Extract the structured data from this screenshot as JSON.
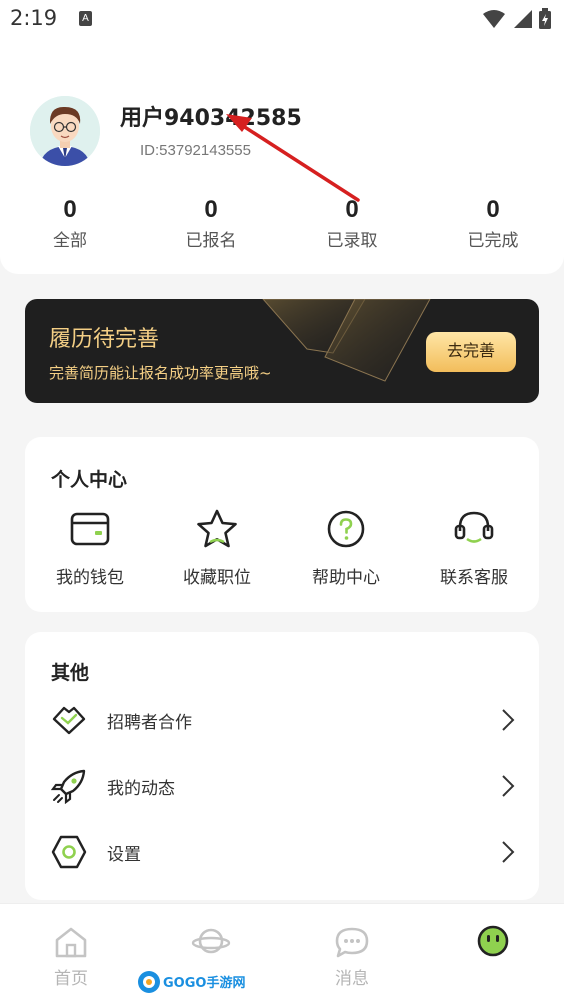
{
  "status_bar": {
    "time": "2:19",
    "badge": "A"
  },
  "profile": {
    "username": "用户940342585",
    "user_id": "ID:53792143555",
    "stats": [
      {
        "value": "0",
        "label": "全部"
      },
      {
        "value": "0",
        "label": "已报名"
      },
      {
        "value": "0",
        "label": "已录取"
      },
      {
        "value": "0",
        "label": "已完成"
      }
    ]
  },
  "resume_banner": {
    "title": "履历待完善",
    "subtitle": "完善简历能让报名成功率更高哦~",
    "button": "去完善"
  },
  "personal_center": {
    "title": "个人中心",
    "items": [
      {
        "label": "我的钱包",
        "icon": "wallet-icon"
      },
      {
        "label": "收藏职位",
        "icon": "star-icon"
      },
      {
        "label": "帮助中心",
        "icon": "help-icon"
      },
      {
        "label": "联系客服",
        "icon": "headset-icon"
      }
    ]
  },
  "other": {
    "title": "其他",
    "items": [
      {
        "label": "招聘者合作",
        "icon": "handshake-icon"
      },
      {
        "label": "我的动态",
        "icon": "rocket-icon"
      },
      {
        "label": "设置",
        "icon": "settings-icon"
      }
    ]
  },
  "bottom_nav": {
    "items": [
      {
        "label": "首页",
        "icon": "home-icon"
      },
      {
        "label": "",
        "icon": "planet-icon"
      },
      {
        "label": "消息",
        "icon": "chat-icon"
      },
      {
        "label": "",
        "icon": "smiley-icon"
      }
    ]
  },
  "watermark": "GOGO手游网",
  "colors": {
    "accent_green": "#8fd14f",
    "banner_gold": "#f4cf85",
    "banner_bg": "#1f1f1f",
    "annotation_red": "#d62020"
  }
}
